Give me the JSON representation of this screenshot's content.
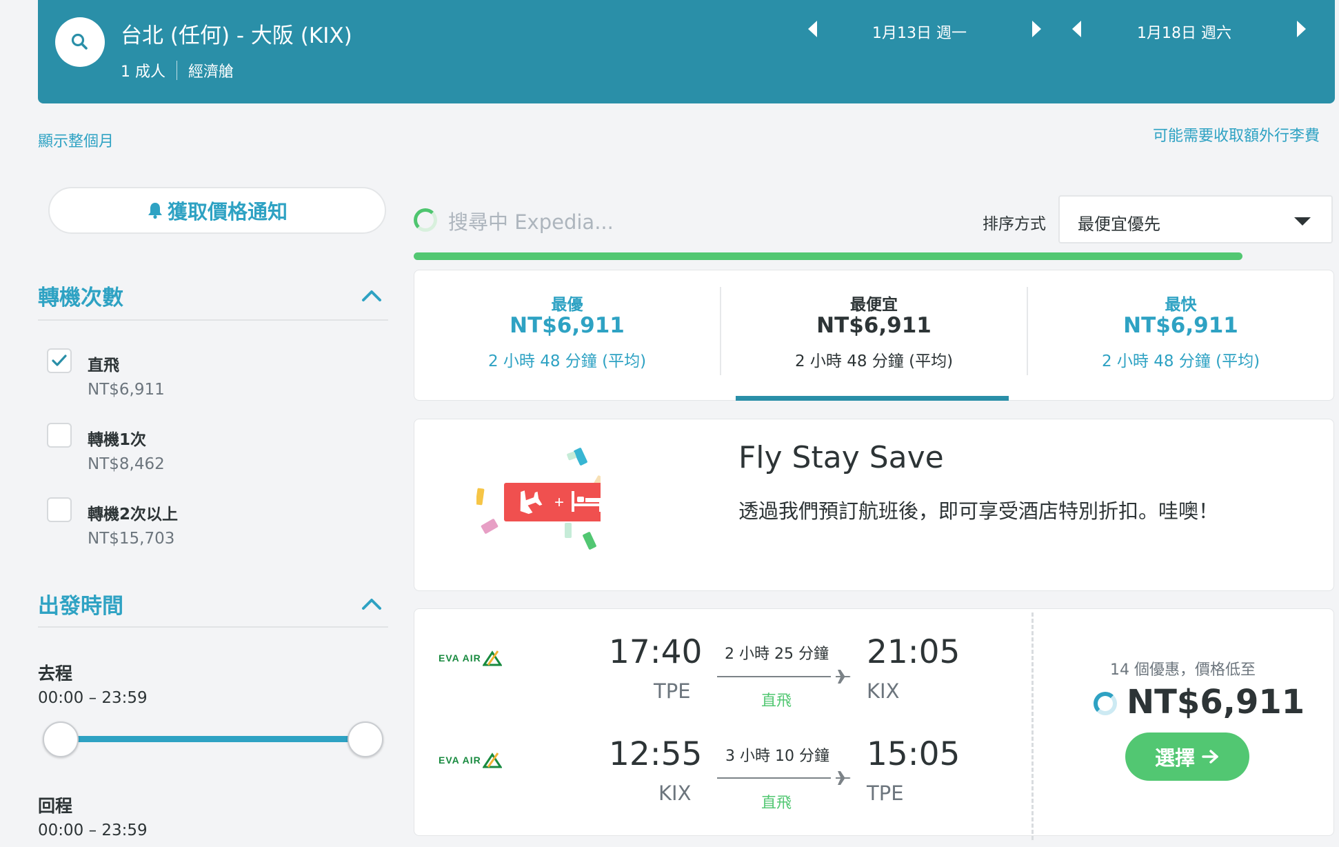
{
  "header": {
    "route": "台北 (任何) - 大阪 (KIX)",
    "passengers": "1 成人",
    "cabin": "經濟艙",
    "depart_date": "1月13日 週一",
    "return_date": "1月18日 週六"
  },
  "links": {
    "show_month": "顯示整個月",
    "baggage_fee": "可能需要收取額外行李費"
  },
  "sidebar": {
    "price_alert": "獲取價格通知",
    "stops_title": "轉機次數",
    "stops": [
      {
        "label": "直飛",
        "price": "NT$6,911",
        "checked": true
      },
      {
        "label": "轉機1次",
        "price": "NT$8,462",
        "checked": false
      },
      {
        "label": "轉機2次以上",
        "price": "NT$15,703",
        "checked": false
      }
    ],
    "departure_title": "出發時間",
    "outbound_label": "去程",
    "outbound_range": "00:00 – 23:59",
    "return_label": "回程",
    "return_range": "00:00 – 23:59"
  },
  "search_status": "搜尋中 Expedia...",
  "sort": {
    "label": "排序方式",
    "value": "最便宜優先"
  },
  "progress_fraction": 0.9,
  "tabs": [
    {
      "label": "最優",
      "price": "NT$6,911",
      "duration": "2 小時 48 分鐘 (平均)"
    },
    {
      "label": "最便宜",
      "price": "NT$6,911",
      "duration": "2 小時 48 分鐘 (平均)",
      "active": true
    },
    {
      "label": "最快",
      "price": "NT$6,911",
      "duration": "2 小時 48 分鐘 (平均)"
    }
  ],
  "promo": {
    "title": "Fly Stay Save",
    "description": "透過我們預訂航班後，即可享受酒店特別折扣。哇噢！"
  },
  "result": {
    "airline_logo_text": "EVA AIR",
    "legs": [
      {
        "depart_time": "17:40",
        "depart_code": "TPE",
        "duration": "2 小時 25 分鐘",
        "stops": "直飛",
        "arrive_time": "21:05",
        "arrive_code": "KIX"
      },
      {
        "depart_time": "12:55",
        "depart_code": "KIX",
        "duration": "3 小時 10 分鐘",
        "stops": "直飛",
        "arrive_time": "15:05",
        "arrive_code": "TPE"
      }
    ],
    "deals": "14 個優惠，價格低至",
    "price": "NT$6,911",
    "select_label": "選擇"
  },
  "colors": {
    "header_bg": "#2a8fa8",
    "accent": "#2ea2c3",
    "green": "#52c772"
  }
}
